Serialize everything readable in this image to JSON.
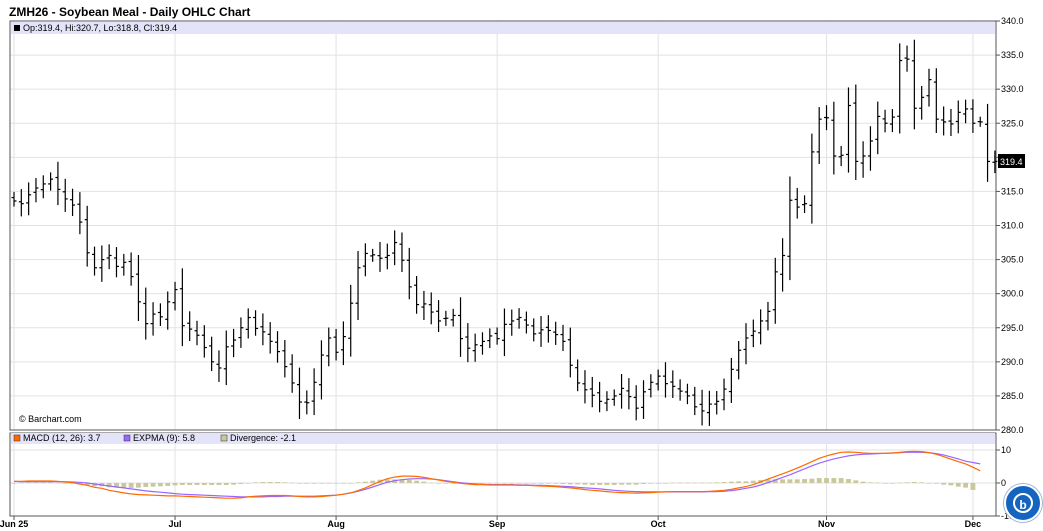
{
  "title": "ZMH26 - Soybean Meal - Daily OHLC Chart",
  "ohlc_label": "Op:319.4, Hi:320.7, Lo:318.8, Cl:319.4",
  "watermark": "© Barchart.com",
  "last_price_label": "319.4",
  "badge_icon": "barchart-assistant-icon",
  "colors": {
    "legend_band": "#e3e3fa",
    "macd": "#ff6a00",
    "expma": "#9966ff",
    "divergence": "#c8c89a",
    "badge": "#1565c0"
  },
  "indicator_legend": {
    "macd": "MACD (12, 26): 3.7",
    "expma": "EXPMA (9): 5.8",
    "divergence": "Divergence: -2.1"
  },
  "chart_data": [
    {
      "type": "ohlc",
      "ylim": [
        280,
        340
      ],
      "yticks": [
        "340.0",
        "335.0",
        "330.0",
        "325.0",
        "320.0",
        "315.0",
        "310.0",
        "305.0",
        "300.0",
        "295.0",
        "290.0",
        "285.0",
        "280.0"
      ],
      "xticks": [
        {
          "label": "Jun 25",
          "index": 0
        },
        {
          "label": "Jul",
          "index": 22
        },
        {
          "label": "Aug",
          "index": 44
        },
        {
          "label": "Sep",
          "index": 66
        },
        {
          "label": "Oct",
          "index": 88
        },
        {
          "label": "Nov",
          "index": 111
        },
        {
          "label": "Dec",
          "index": 131
        }
      ],
      "close": [
        313.6,
        313.2,
        314.5,
        315.5,
        316.1,
        316.8,
        315.3,
        313.9,
        313.0,
        310.5,
        306.0,
        303.8,
        305.0,
        305.6,
        304.0,
        304.6,
        302.5,
        298.8,
        295.6,
        297.0,
        296.6,
        298.8,
        300.6,
        295.3,
        294.8,
        293.9,
        292.1,
        290.0,
        289.1,
        292.2,
        293.2,
        295.0,
        296.5,
        294.9,
        294.4,
        293.0,
        291.5,
        289.3,
        286.9,
        284.1,
        284.0,
        287.0,
        291.0,
        293.5,
        291.4,
        293.7,
        298.6,
        303.8,
        305.9,
        305.7,
        305.2,
        305.6,
        307.5,
        304.9,
        301.0,
        298.4,
        298.5,
        297.3,
        296.0,
        296.4,
        296.8,
        293.4,
        292.0,
        292.5,
        293.0,
        293.8,
        293.4,
        295.5,
        296.0,
        296.5,
        295.4,
        294.1,
        294.7,
        294.6,
        294.0,
        293.0,
        289.5,
        286.9,
        285.9,
        285.1,
        284.2,
        284.5,
        285.0,
        286.1,
        284.9,
        283.2,
        285.6,
        287.0,
        287.9,
        286.8,
        286.4,
        285.7,
        285.0,
        283.4,
        282.8,
        283.8,
        284.2,
        286.0,
        288.9,
        291.7,
        293.5,
        294.5,
        296.0,
        297.4,
        303.2,
        305.6,
        313.7,
        312.7,
        313.2,
        320.8,
        325.6,
        325.8,
        320.2,
        320.3,
        327.6,
        319.4,
        320.2,
        322.4,
        326.0,
        325.0,
        325.9,
        334.2,
        334.4,
        327.2,
        328.8,
        331.4,
        325.6,
        325.2,
        324.9,
        326.6,
        327.1,
        325.0,
        325.2,
        319.4,
        319.4
      ]
    },
    {
      "type": "line+bar",
      "ylim": [
        -10,
        10
      ],
      "yticks": [
        "10",
        "0",
        "-10"
      ],
      "series": [
        {
          "name": "MACD (12, 26)",
          "values": [
            0.5,
            0.5,
            0.6,
            0.6,
            0.6,
            0.6,
            0.5,
            0.3,
            0.1,
            -0.3,
            -0.7,
            -1.3,
            -1.6,
            -2.2,
            -2.6,
            -3.0,
            -3.3,
            -3.5,
            -3.6,
            -3.7,
            -3.8,
            -3.9,
            -3.9,
            -4.0,
            -4.1,
            -4.2,
            -4.3,
            -4.4,
            -4.5,
            -4.6,
            -4.6,
            -4.5,
            -4.2,
            -4.0,
            -3.9,
            -3.8,
            -3.8,
            -3.8,
            -3.9,
            -4.1,
            -4.2,
            -4.2,
            -4.1,
            -3.9,
            -3.7,
            -3.4,
            -3.0,
            -2.3,
            -1.5,
            -0.5,
            0.5,
            1.3,
            1.8,
            2.1,
            2.1,
            2.0,
            1.7,
            1.3,
            0.9,
            0.5,
            0.2,
            -0.1,
            -0.3,
            -0.5,
            -0.5,
            -0.6,
            -0.6,
            -0.6,
            -0.6,
            -0.7,
            -0.7,
            -0.8,
            -0.9,
            -1.0,
            -1.1,
            -1.3,
            -1.5,
            -1.7,
            -2.0,
            -2.2,
            -2.4,
            -2.6,
            -2.8,
            -2.9,
            -3.0,
            -3.1,
            -3.0,
            -2.9,
            -2.8,
            -2.7,
            -2.6,
            -2.6,
            -2.6,
            -2.6,
            -2.6,
            -2.5,
            -2.4,
            -2.2,
            -1.9,
            -1.5,
            -1.1,
            -0.5,
            0.3,
            1.2,
            2.0,
            2.8,
            3.6,
            4.5,
            5.5,
            6.5,
            7.5,
            8.2,
            8.8,
            9.3,
            9.4,
            9.3,
            9.1,
            9.0,
            9.0,
            9.0,
            9.1,
            9.3,
            9.5,
            9.6,
            9.5,
            9.2,
            8.7,
            8.0,
            7.2,
            6.5,
            5.8,
            4.8,
            3.7
          ]
        },
        {
          "name": "EXPMA (9)",
          "values": [
            0.5,
            0.4,
            0.4,
            0.4,
            0.4,
            0.4,
            0.4,
            0.4,
            0.3,
            0.2,
            0.0,
            -0.3,
            -0.6,
            -0.9,
            -1.2,
            -1.5,
            -1.8,
            -2.1,
            -2.4,
            -2.6,
            -2.8,
            -3.0,
            -3.2,
            -3.4,
            -3.5,
            -3.6,
            -3.7,
            -3.8,
            -3.9,
            -4.0,
            -4.1,
            -4.2,
            -4.2,
            -4.2,
            -4.2,
            -4.1,
            -4.1,
            -4.0,
            -4.0,
            -4.0,
            -4.0,
            -4.0,
            -3.9,
            -3.8,
            -3.7,
            -3.4,
            -3.0,
            -2.5,
            -1.9,
            -1.2,
            -0.5,
            0.2,
            0.7,
            1.0,
            1.2,
            1.3,
            1.3,
            1.2,
            1.0,
            0.7,
            0.4,
            0.1,
            -0.1,
            -0.3,
            -0.4,
            -0.5,
            -0.5,
            -0.5,
            -0.5,
            -0.6,
            -0.6,
            -0.7,
            -0.7,
            -0.8,
            -0.9,
            -1.0,
            -1.1,
            -1.3,
            -1.5,
            -1.6,
            -1.8,
            -2.0,
            -2.2,
            -2.4,
            -2.5,
            -2.6,
            -2.7,
            -2.7,
            -2.7,
            -2.7,
            -2.7,
            -2.7,
            -2.7,
            -2.7,
            -2.7,
            -2.6,
            -2.6,
            -2.5,
            -2.3,
            -2.0,
            -1.6,
            -1.2,
            -0.6,
            0.1,
            0.9,
            1.7,
            2.5,
            3.4,
            4.3,
            5.2,
            6.0,
            6.7,
            7.3,
            7.8,
            8.2,
            8.5,
            8.7,
            8.8,
            8.9,
            9.0,
            9.1,
            9.2,
            9.3,
            9.3,
            9.3,
            9.2,
            8.9,
            8.5,
            7.9,
            7.3,
            6.6,
            6.2,
            5.8
          ]
        },
        {
          "name": "Divergence",
          "values": [
            0.0,
            0.1,
            0.2,
            0.2,
            0.2,
            0.2,
            0.1,
            -0.1,
            -0.2,
            -0.5,
            -0.7,
            -1.0,
            -1.0,
            -1.3,
            -1.4,
            -1.5,
            -1.5,
            -1.4,
            -1.2,
            -1.1,
            -1.0,
            -0.9,
            -0.7,
            -0.6,
            -0.6,
            -0.6,
            -0.6,
            -0.6,
            -0.6,
            -0.6,
            -0.5,
            -0.3,
            0.0,
            0.2,
            0.3,
            0.3,
            0.3,
            0.2,
            0.1,
            -0.1,
            -0.2,
            -0.2,
            -0.2,
            -0.1,
            0.0,
            0.0,
            0.0,
            0.2,
            0.4,
            0.7,
            1.0,
            1.1,
            1.1,
            1.1,
            0.9,
            0.7,
            0.4,
            0.1,
            -0.1,
            -0.2,
            -0.2,
            -0.2,
            -0.2,
            -0.2,
            -0.1,
            -0.1,
            -0.1,
            -0.1,
            -0.1,
            -0.1,
            -0.1,
            -0.1,
            -0.2,
            -0.2,
            -0.2,
            -0.3,
            -0.4,
            -0.4,
            -0.5,
            -0.6,
            -0.6,
            -0.6,
            -0.6,
            -0.5,
            -0.5,
            -0.5,
            -0.3,
            -0.2,
            -0.1,
            0.0,
            0.1,
            0.1,
            0.1,
            0.1,
            0.1,
            0.1,
            0.2,
            0.3,
            0.4,
            0.5,
            0.5,
            0.7,
            0.9,
            1.1,
            1.1,
            1.1,
            1.1,
            1.1,
            1.2,
            1.3,
            1.5,
            1.5,
            1.5,
            1.5,
            1.2,
            0.8,
            0.4,
            0.2,
            0.1,
            0.0,
            0.0,
            0.1,
            0.2,
            0.3,
            0.2,
            0.0,
            -0.2,
            -0.5,
            -0.7,
            -1.1,
            -1.4,
            -2.1
          ]
        }
      ]
    }
  ]
}
